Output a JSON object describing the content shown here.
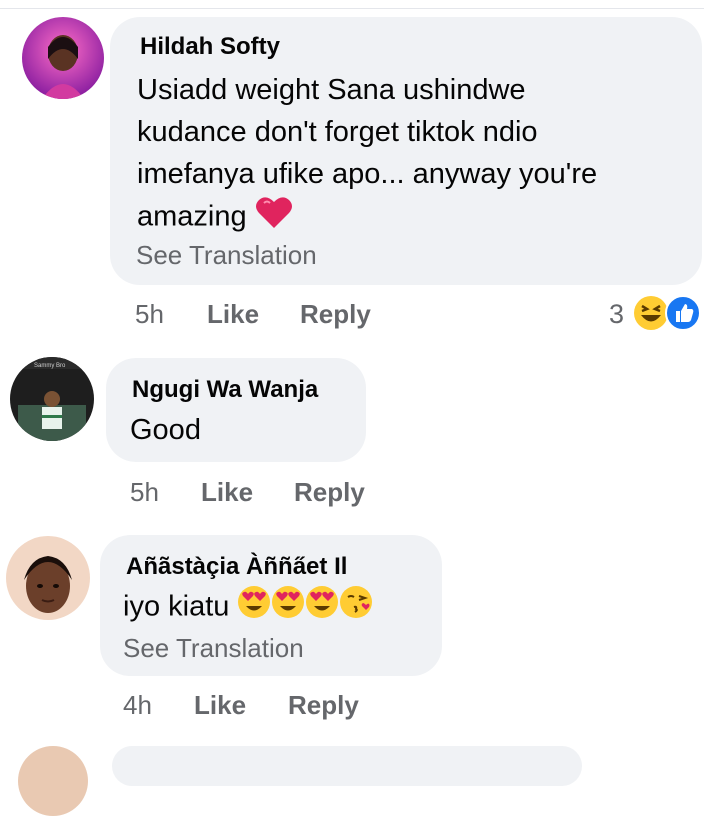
{
  "comments": [
    {
      "author": "Hildah Softy",
      "text_lines": [
        "Usiadd weight Sana ushindwe",
        "kudance don't forget tiktok ndio",
        "imefanya ufike apo... anyway you're",
        "amazing"
      ],
      "see_translation": "See Translation",
      "time": "5h",
      "like": "Like",
      "reply": "Reply",
      "reaction_count": "3",
      "reaction_icons": [
        "laugh-reaction-icon",
        "like-reaction-icon"
      ],
      "trailing_emojis": [
        "red-heart-emoji"
      ]
    },
    {
      "author": "Ngugi Wa Wanja",
      "avatar_caption": "Sammy Bro",
      "text_lines": [
        "Good"
      ],
      "time": "5h",
      "like": "Like",
      "reply": "Reply"
    },
    {
      "author": "Añãstàçia Àñña̋et Il",
      "text_lines": [
        "iyo kiatu"
      ],
      "see_translation": "See Translation",
      "time": "4h",
      "like": "Like",
      "reply": "Reply",
      "trailing_emojis": [
        "heart-eyes-emoji",
        "heart-eyes-emoji",
        "heart-eyes-emoji",
        "kissing-face-emoji"
      ]
    }
  ],
  "colors": {
    "bubble": "#f0f2f5",
    "secondary_text": "#65676b",
    "primary_text": "#050505",
    "like_blue": "#1877f2",
    "emoji_yellow": "#ffcc33",
    "heart_red": "#e0245e"
  }
}
